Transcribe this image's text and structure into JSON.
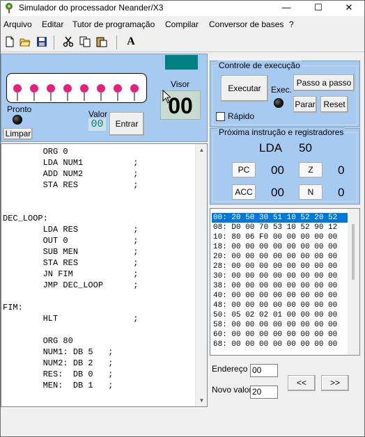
{
  "window": {
    "title": "Simulador do processador Neander/X3",
    "minimize": "—",
    "maximize": "☐",
    "close": "✕"
  },
  "menu": [
    "Arquivo",
    "Editar",
    "Tutor de programação",
    "Compilar",
    "Conversor de bases",
    "?"
  ],
  "toolbar": {
    "icons": [
      "new-file-icon",
      "open-folder-icon",
      "save-icon",
      "cut-icon",
      "copy-icon",
      "paste-icon",
      "font-icon"
    ],
    "font_label": "A"
  },
  "io": {
    "pronto_label": "Pronto",
    "limpar_label": "Limpar",
    "valor_label": "Valor",
    "valor_value": "00",
    "entrar_label": "Entrar",
    "visor_label": "Visor",
    "visor_value": "00",
    "led_count": 8
  },
  "control": {
    "title": "Controle de execução",
    "executar_label": "Executar",
    "passo_label": "Passo a passo",
    "exec_label": "Exec.",
    "parar_label": "Parar",
    "reset_label": "Reset",
    "rapido_label": "Rápido"
  },
  "registers": {
    "title": "Próxima instrução e registradores",
    "next_instr": "LDA",
    "next_operand": "50",
    "pc_label": "PC",
    "pc_value": "00",
    "z_label": "Z",
    "z_value": "0",
    "acc_label": "ACC",
    "acc_value": "00",
    "n_label": "N",
    "n_value": "0"
  },
  "code": [
    "        ORG 0",
    "        LDA NUM1          ;",
    "        ADD NUM2          ;",
    "        STA RES           ;",
    "",
    "",
    "DEC_LOOP:",
    "        LDA RES           ;",
    "        OUT 0             ;",
    "        SUB MEN           ;",
    "        STA RES           ;",
    "        JN FIM            ;",
    "        JMP DEC_LOOP      ;",
    "",
    "FIM:",
    "        HLT               ;",
    "",
    "        ORG 80",
    "        NUM1: DB 5   ;",
    "        NUM2: DB 2   ;",
    "        RES:  DB 0   ;",
    "        MEN:  DB 1   ;"
  ],
  "memory": [
    "00: 20 50 30 51 10 52 20 52",
    "08: D0 00 70 53 10 52 90 12",
    "10: 80 06 F0 00 00 00 00 00",
    "18: 00 00 00 00 00 00 00 00",
    "20: 00 00 00 00 00 00 00 00",
    "28: 00 00 00 00 00 00 00 00",
    "30: 00 00 00 00 00 00 00 00",
    "38: 00 00 00 00 00 00 00 00",
    "40: 00 00 00 00 00 00 00 00",
    "48: 00 00 00 00 00 00 00 00",
    "50: 05 02 02 01 00 00 00 00",
    "58: 00 00 00 00 00 00 00 00",
    "60: 00 00 00 00 00 00 00 00",
    "68: 00 00 00 00 00 00 00 00"
  ],
  "edit": {
    "endereco_label": "Endereço",
    "endereco_value": "00",
    "novo_label": "Novo valor",
    "novo_value": "20",
    "prev_label": "<<",
    "next_label": ">>"
  }
}
